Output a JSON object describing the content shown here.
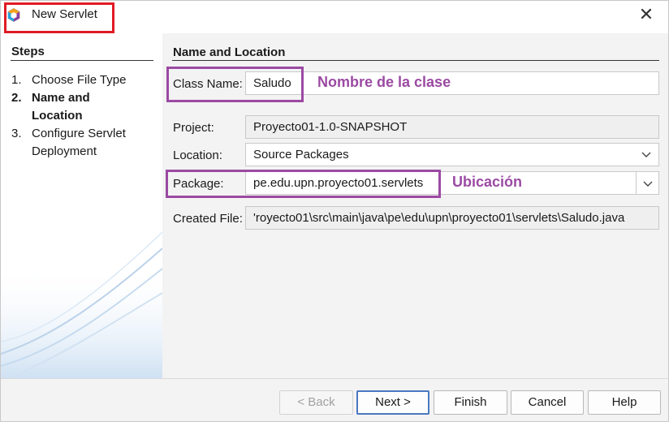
{
  "window": {
    "title": "New Servlet",
    "close_glyph": "✕"
  },
  "steps": {
    "header": "Steps",
    "items": [
      {
        "num": "1.",
        "label": "Choose File Type"
      },
      {
        "num": "2.",
        "label": "Name and Location"
      },
      {
        "num": "3.",
        "label": "Configure Servlet Deployment"
      }
    ]
  },
  "form": {
    "section_title": "Name and Location",
    "class_name_label": "Class Name:",
    "class_name_value": "Saludo",
    "project_label": "Project:",
    "project_value": "Proyecto01-1.0-SNAPSHOT",
    "location_label": "Location:",
    "location_value": "Source Packages",
    "package_label": "Package:",
    "package_value": "pe.edu.upn.proyecto01.servlets",
    "created_file_label": "Created File:",
    "created_file_value": "'royecto01\\src\\main\\java\\pe\\edu\\upn\\proyecto01\\servlets\\Saludo.java"
  },
  "annotations": {
    "class_name_note": "Nombre de la clase",
    "package_note": "Ubicación",
    "color": "#9b4aa3"
  },
  "buttons": {
    "back": "< Back",
    "next": "Next >",
    "finish": "Finish",
    "cancel": "Cancel",
    "help": "Help"
  },
  "colors": {
    "title_highlight": "#e01b24",
    "annotation": "#9b4aa3",
    "default_button_border": "#4a78c2"
  },
  "icons": {
    "app": "netbeans-cube-icon",
    "close": "close-icon",
    "combo": "chevron-down-icon"
  }
}
